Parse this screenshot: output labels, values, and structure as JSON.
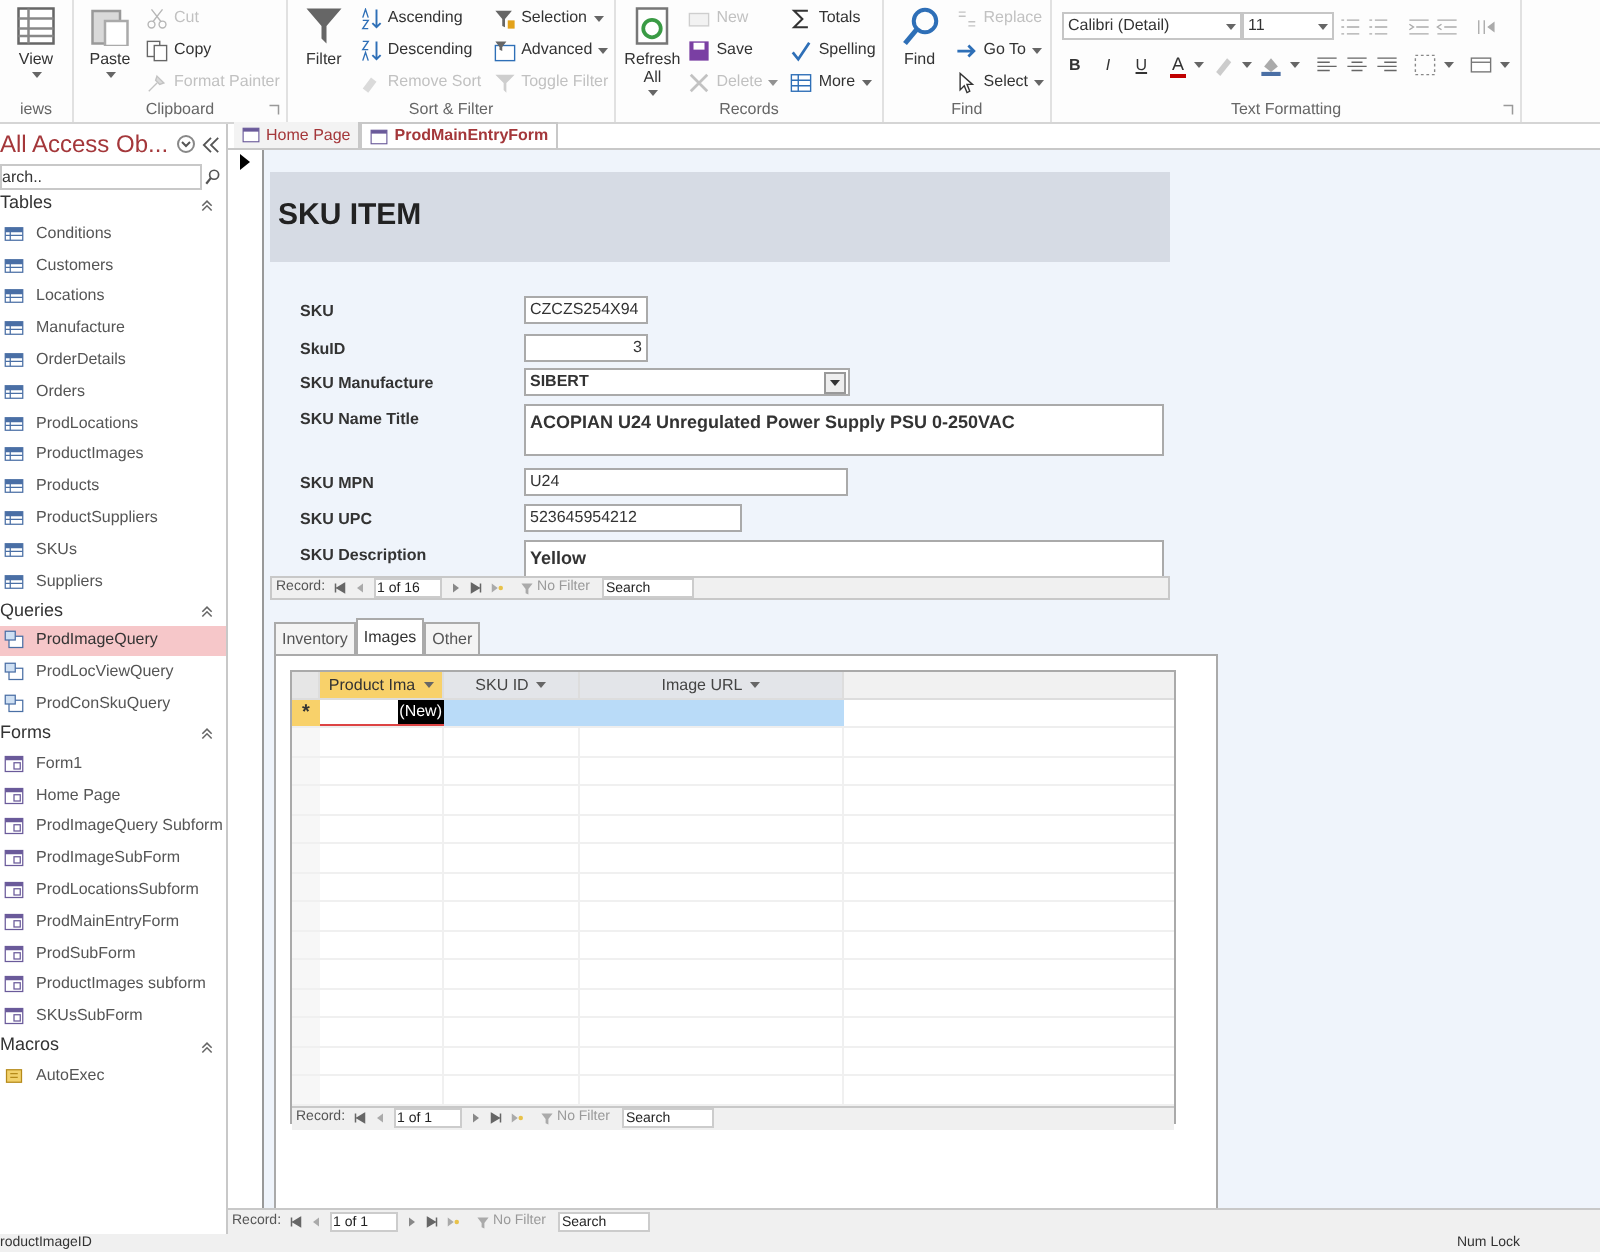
{
  "ribbon": {
    "groups": [
      {
        "label": "iews",
        "large": [
          {
            "label": "View",
            "dropdown": true
          }
        ]
      },
      {
        "label": "Clipboard",
        "large": [
          {
            "label": "Paste",
            "dropdown": true
          }
        ],
        "small": [
          {
            "label": "Cut",
            "disabled": true,
            "dropdown": false
          },
          {
            "label": "Copy",
            "disabled": false,
            "dropdown": false
          },
          {
            "label": "Format Painter",
            "disabled": true,
            "dropdown": false
          }
        ]
      },
      {
        "label": "Sort & Filter",
        "large": [
          {
            "label": "Filter",
            "dropdown": false
          }
        ],
        "small": [
          {
            "label": "Ascending",
            "disabled": false,
            "dropdown": false
          },
          {
            "label": "Descending",
            "disabled": false,
            "dropdown": false
          },
          {
            "label": "Remove Sort",
            "disabled": true,
            "dropdown": false
          },
          {
            "label": "Selection",
            "disabled": false,
            "dropdown": true
          },
          {
            "label": "Advanced",
            "disabled": false,
            "dropdown": true
          },
          {
            "label": "Toggle Filter",
            "disabled": true,
            "dropdown": false
          }
        ]
      },
      {
        "label": "Records",
        "large": [
          {
            "label": "Refresh All",
            "dropdown": true
          }
        ],
        "small": [
          {
            "label": "New",
            "disabled": true,
            "dropdown": false
          },
          {
            "label": "Save",
            "disabled": false,
            "dropdown": false
          },
          {
            "label": "Delete",
            "disabled": true,
            "dropdown": true
          },
          {
            "label": "Totals",
            "disabled": false,
            "dropdown": false
          },
          {
            "label": "Spelling",
            "disabled": false,
            "dropdown": false
          },
          {
            "label": "More",
            "disabled": false,
            "dropdown": true
          }
        ]
      },
      {
        "label": "Find",
        "large": [
          {
            "label": "Find",
            "dropdown": false
          }
        ],
        "small": [
          {
            "label": "Replace",
            "disabled": true,
            "dropdown": false
          },
          {
            "label": "Go To",
            "disabled": false,
            "dropdown": true
          },
          {
            "label": "Select",
            "disabled": false,
            "dropdown": true
          }
        ]
      }
    ],
    "text_formatting": {
      "label": "Text Formatting",
      "font": "Calibri (Detail)",
      "size": "11",
      "buttons": [
        "B",
        "I",
        "U"
      ],
      "font_color": "A"
    }
  },
  "navigation": {
    "title": "All Access Ob...",
    "search_placeholder": "arch..",
    "sections": [
      {
        "title": "Tables",
        "kind": "table",
        "items": [
          {
            "label": "Conditions",
            "selected": false
          },
          {
            "label": "Customers",
            "selected": false
          },
          {
            "label": "Locations",
            "selected": false
          },
          {
            "label": "Manufacture",
            "selected": false
          },
          {
            "label": "OrderDetails",
            "selected": false
          },
          {
            "label": "Orders",
            "selected": false
          },
          {
            "label": "ProdLocations",
            "selected": false
          },
          {
            "label": "ProductImages",
            "selected": false
          },
          {
            "label": "Products",
            "selected": false
          },
          {
            "label": "ProductSuppliers",
            "selected": false
          },
          {
            "label": "SKUs",
            "selected": false
          },
          {
            "label": "Suppliers",
            "selected": false
          }
        ]
      },
      {
        "title": "Queries",
        "kind": "query",
        "items": [
          {
            "label": "ProdImageQuery",
            "selected": true
          },
          {
            "label": "ProdLocViewQuery",
            "selected": false
          },
          {
            "label": "ProdConSkuQuery",
            "selected": false
          }
        ]
      },
      {
        "title": "Forms",
        "kind": "form",
        "items": [
          {
            "label": "Form1",
            "selected": false
          },
          {
            "label": "Home Page",
            "selected": false
          },
          {
            "label": "ProdImageQuery Subform",
            "selected": false
          },
          {
            "label": "ProdImageSubForm",
            "selected": false
          },
          {
            "label": "ProdLocationsSubform",
            "selected": false
          },
          {
            "label": "ProdMainEntryForm",
            "selected": false
          },
          {
            "label": "ProdSubForm",
            "selected": false
          },
          {
            "label": "ProductImages subform",
            "selected": false
          },
          {
            "label": "SKUsSubForm",
            "selected": false
          }
        ]
      },
      {
        "title": "Macros",
        "kind": "macro",
        "items": [
          {
            "label": "AutoExec",
            "selected": false
          }
        ]
      }
    ]
  },
  "document_tabs": [
    {
      "label": "Home Page",
      "selected": false
    },
    {
      "label": "ProdMainEntryForm",
      "selected": true
    }
  ],
  "form": {
    "title": "SKU ITEM",
    "fields": [
      {
        "label": "SKU",
        "value": "CZCZS254X94",
        "kind": "text"
      },
      {
        "label": "SkuID",
        "value": "3",
        "kind": "number"
      },
      {
        "label": "SKU Manufacture",
        "value": "SIBERT",
        "kind": "combo"
      },
      {
        "label": "SKU Name Title",
        "value": "ACOPIAN U24 Unregulated Power Supply PSU 0-250VAC",
        "kind": "memo"
      },
      {
        "label": "SKU MPN",
        "value": "U24",
        "kind": "text"
      },
      {
        "label": "SKU UPC",
        "value": "523645954212",
        "kind": "text"
      },
      {
        "label": "SKU Description",
        "value": "Yellow",
        "kind": "memo"
      }
    ],
    "record_bar": {
      "label": "Record:",
      "position": "1 of 16",
      "filter": "No Filter",
      "search": "Search"
    },
    "subtabs": [
      {
        "label": "Inventory",
        "selected": false
      },
      {
        "label": "Images",
        "selected": true
      },
      {
        "label": "Other",
        "selected": false
      }
    ],
    "datasheet": {
      "columns": [
        {
          "label": "Product Ima",
          "selected": true
        },
        {
          "label": "SKU ID",
          "selected": false
        },
        {
          "label": "Image URL",
          "selected": false
        }
      ],
      "new_row": {
        "marker": "*",
        "value": "(New)"
      },
      "record_bar": {
        "label": "Record:",
        "position": "1 of 1",
        "filter": "No Filter",
        "search": "Search"
      }
    }
  },
  "record_bar": {
    "label": "Record:",
    "position": "1 of 1",
    "filter": "No Filter",
    "search": "Search"
  },
  "status_bar": {
    "left": "roductImageID",
    "right": "Num Lock"
  }
}
